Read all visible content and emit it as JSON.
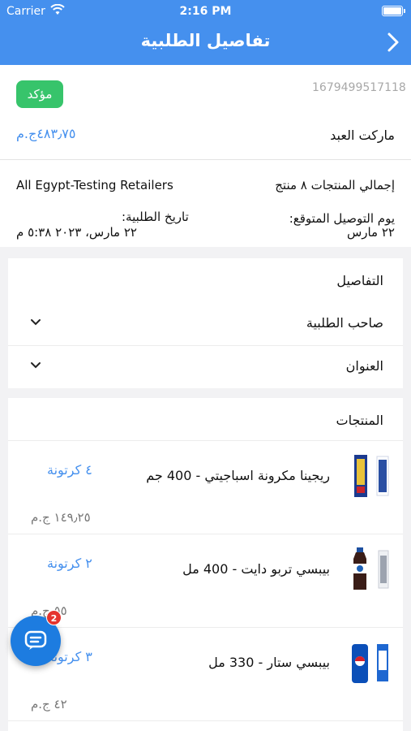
{
  "status_bar": {
    "carrier": "Carrier",
    "time": "2:16 PM"
  },
  "nav": {
    "title": "تفاصيل الطلبية",
    "back_icon": "chevron-right-icon"
  },
  "summary": {
    "order_id": "1679499517118",
    "status": "مؤكد",
    "store_name": "ماركت العبد",
    "total_price": "٤٨٣٫٧٥ج.م",
    "products_count": "إجمالي المنتجات ٨ منتج",
    "retailer": "All Egypt-Testing Retailers",
    "delivery_label": "يوم التوصيل المتوقع:",
    "delivery_value": "٢٢ مارس",
    "order_date_label": "تاريخ الطلبية:",
    "order_date_value": "٢٢ مارس، ٢٠٢٣ ٥:٣٨ م"
  },
  "details": {
    "title": "التفاصيل",
    "rows": [
      {
        "label": "صاحب الطلبية",
        "icon": "chevron-down-icon"
      },
      {
        "label": "العنوان",
        "icon": "chevron-down-icon"
      }
    ]
  },
  "products": {
    "title": "المنتجات",
    "items": [
      {
        "name": "ريجينا مكرونة اسباجيتي - 400 جم",
        "quantity": "٤ كرتونة",
        "price": "١٤٩٫٢٥ ج.م"
      },
      {
        "name": "بيبسي تربو دايت - 400 مل",
        "quantity": "٢ كرتونة",
        "price": "٥٥ ج.م"
      },
      {
        "name": "بيبسي ستار - 330 مل",
        "quantity": "٣ كرتونة",
        "price": "٤٢ ج.م"
      }
    ]
  },
  "chat": {
    "badge": "2",
    "icon": "chat-icon"
  },
  "colors": {
    "primary": "#4590ee",
    "status_green": "#37c46b",
    "badge_red": "#e5342e"
  }
}
